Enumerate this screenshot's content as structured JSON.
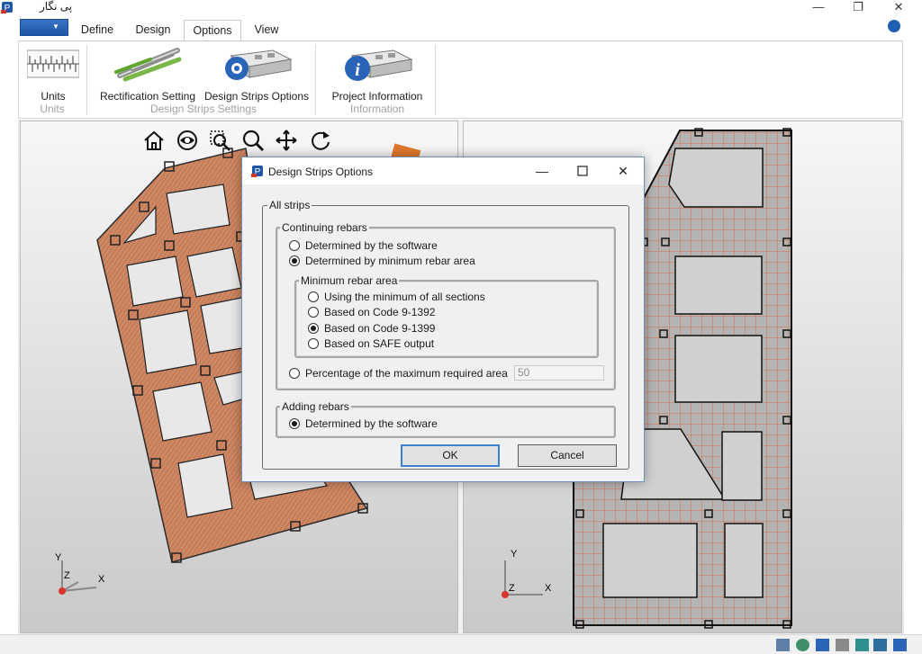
{
  "app": {
    "title": "پی نگار",
    "window_controls": [
      "—",
      "❐",
      "✕"
    ]
  },
  "menu": {
    "file_arrow": "▼",
    "tabs": [
      {
        "label": "Define"
      },
      {
        "label": "Design"
      },
      {
        "label": "Options",
        "active": true
      },
      {
        "label": "View"
      }
    ]
  },
  "ribbon": {
    "groups": [
      {
        "label": "Units",
        "buttons": [
          {
            "label": "Units",
            "icon": "ruler-icon"
          }
        ]
      },
      {
        "label": "Design Strips Settings",
        "buttons": [
          {
            "label": "Rectification Setting",
            "icon": "rebars-icon"
          },
          {
            "label": "Design Strips Options",
            "icon": "strip-options-gear-icon"
          }
        ]
      },
      {
        "label": "Information",
        "buttons": [
          {
            "label": "Project Information",
            "icon": "project-info-icon"
          }
        ]
      }
    ]
  },
  "view_toolbar": [
    "home-icon",
    "eye-icon",
    "zoom-window-icon",
    "zoom-icon",
    "pan-icon",
    "rotate-icon"
  ],
  "axes": {
    "x": "X",
    "y": "Y",
    "z": "Z"
  },
  "dialog": {
    "title": "Design Strips Options",
    "all_strips_label": "All strips",
    "continuing": {
      "label": "Continuing rebars",
      "options": [
        {
          "label": "Determined by the software",
          "checked": false
        },
        {
          "label": "Determined by minimum rebar area",
          "checked": true
        }
      ],
      "minimum": {
        "label": "Minimum rebar area",
        "options": [
          {
            "label": "Using the minimum of all sections",
            "checked": false
          },
          {
            "label": "Based on Code 9-1392",
            "checked": false
          },
          {
            "label": "Based on Code 9-1399",
            "checked": true
          },
          {
            "label": "Based on SAFE output",
            "checked": false
          }
        ]
      },
      "percentage": {
        "label": "Percentage of the maximum required area",
        "checked": false,
        "value": "50"
      }
    },
    "adding": {
      "label": "Adding rebars",
      "options": [
        {
          "label": "Determined by the software",
          "checked": true
        }
      ]
    },
    "ok_label": "OK",
    "cancel_label": "Cancel"
  },
  "colors": {
    "accent": "#1f56a8",
    "strip": "#c98a6a",
    "rebar": "#e0602a"
  }
}
